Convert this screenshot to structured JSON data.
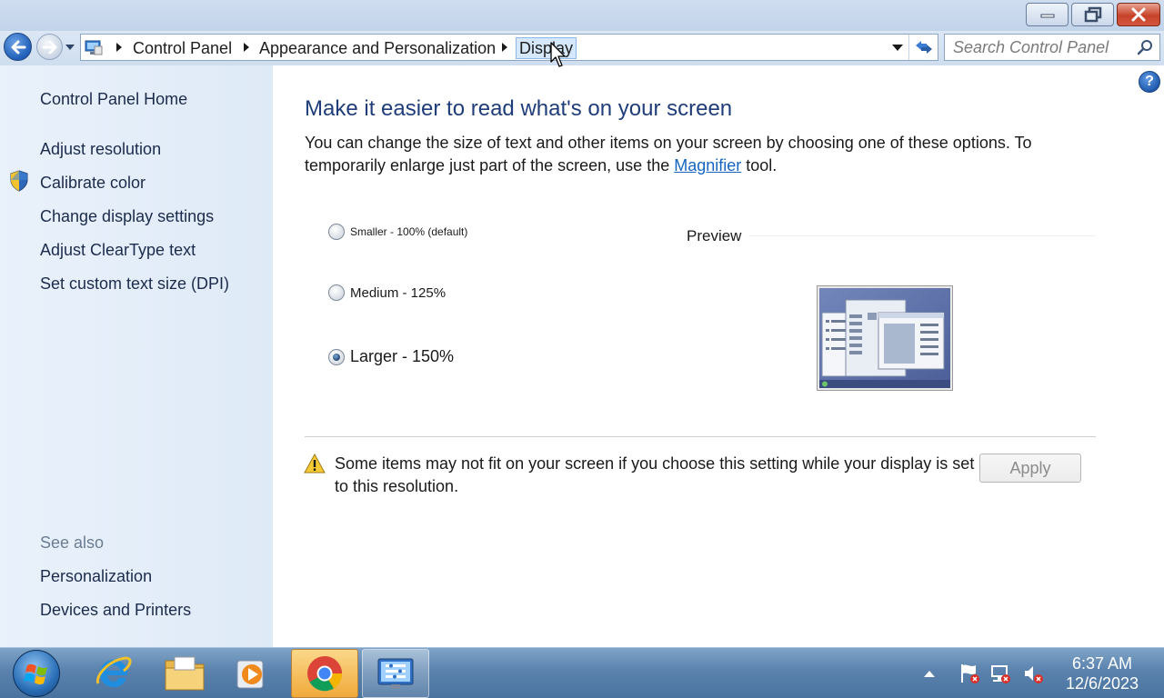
{
  "window": {
    "minimize_label": "Minimize",
    "maximize_label": "Restore",
    "close_label": "Close"
  },
  "address": {
    "breadcrumbs": [
      "Control Panel",
      "Appearance and Personalization",
      "Display"
    ],
    "search_placeholder": "Search Control Panel"
  },
  "sidebar": {
    "home": "Control Panel Home",
    "items": [
      "Adjust resolution",
      "Calibrate color",
      "Change display settings",
      "Adjust ClearType text",
      "Set custom text size (DPI)"
    ],
    "see_also_heading": "See also",
    "see_also": [
      "Personalization",
      "Devices and Printers"
    ]
  },
  "main": {
    "help": "?",
    "title": "Make it easier to read what's on your screen",
    "desc_before": "You can change the size of text and other items on your screen by choosing one of these options. To temporarily enlarge just part of the screen, use the ",
    "desc_link": "Magnifier",
    "desc_after": " tool.",
    "options": [
      {
        "label": "Smaller - 100% (default)",
        "checked": false
      },
      {
        "label": "Medium - 125%",
        "checked": false
      },
      {
        "label": "Larger - 150%",
        "checked": true
      }
    ],
    "preview_label": "Preview",
    "warning": "Some items may not fit on your screen if you choose this setting while your display is set to this resolution.",
    "apply_label": "Apply"
  },
  "taskbar": {
    "apps": [
      "start",
      "internet-explorer",
      "file-explorer",
      "media-player",
      "chrome",
      "control-panel"
    ],
    "clock_time": "6:37 AM",
    "clock_date": "12/6/2023"
  },
  "colors": {
    "accent": "#1f3d7a",
    "link": "#1565c0",
    "sidebar_bg": "#e6eff9"
  }
}
